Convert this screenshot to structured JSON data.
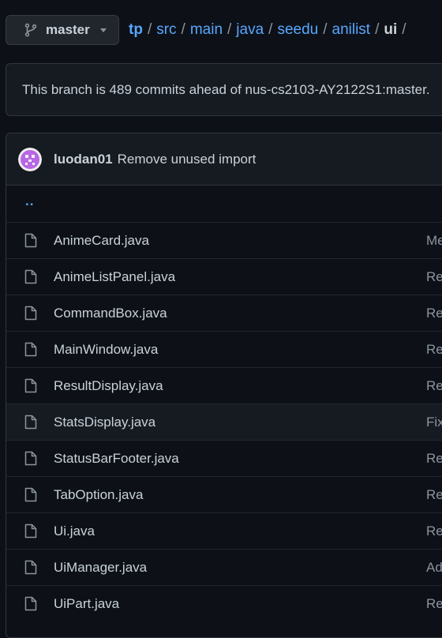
{
  "branch": {
    "name": "master",
    "icon": "git-branch-icon"
  },
  "breadcrumb": {
    "segments": [
      "tp",
      "src",
      "main",
      "java",
      "seedu",
      "anilist"
    ],
    "current": "ui",
    "separator": "/"
  },
  "ahead_notice": "This branch is 489 commits ahead of nus-cs2103-AY2122S1:master.",
  "latest_commit": {
    "author": "luodan01",
    "message": "Remove unused import",
    "avatar_color": "#b866e6"
  },
  "parent_link": "..",
  "files": [
    {
      "name": "AnimeCard.java",
      "commit": "Me"
    },
    {
      "name": "AnimeListPanel.java",
      "commit": "Re"
    },
    {
      "name": "CommandBox.java",
      "commit": "Re"
    },
    {
      "name": "MainWindow.java",
      "commit": "Re"
    },
    {
      "name": "ResultDisplay.java",
      "commit": "Re"
    },
    {
      "name": "StatsDisplay.java",
      "commit": "Fix"
    },
    {
      "name": "StatusBarFooter.java",
      "commit": "Re"
    },
    {
      "name": "TabOption.java",
      "commit": "Re"
    },
    {
      "name": "Ui.java",
      "commit": "Re"
    },
    {
      "name": "UiManager.java",
      "commit": "Ad"
    },
    {
      "name": "UiPart.java",
      "commit": "Re"
    }
  ],
  "colors": {
    "background": "#0d1117",
    "link": "#58a6ff",
    "border": "#30363d",
    "muted": "#8b949e"
  }
}
